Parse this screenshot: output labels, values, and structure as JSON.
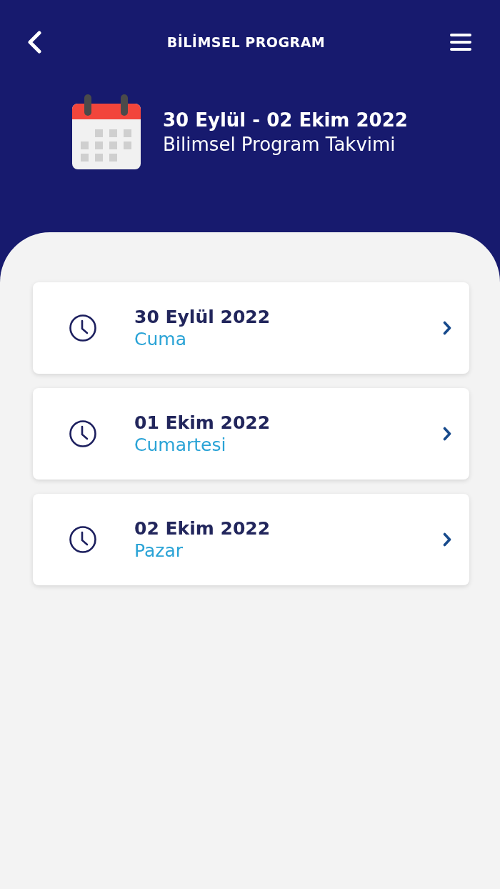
{
  "header": {
    "title": "BİLİMSEL PROGRAM"
  },
  "summary": {
    "dates": "30 Eylül - 02 Ekim 2022",
    "subtitle": "Bilimsel Program Takvimi"
  },
  "days": [
    {
      "date": "30 Eylül 2022",
      "weekday": "Cuma"
    },
    {
      "date": "01 Ekim 2022",
      "weekday": "Cumartesi"
    },
    {
      "date": "02 Ekim 2022",
      "weekday": "Pazar"
    }
  ]
}
